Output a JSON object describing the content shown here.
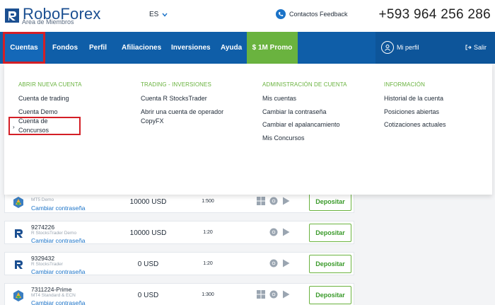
{
  "header": {
    "logo_text": "RoboForex",
    "logo_subtitle": "Área de Miembros",
    "language": "ES",
    "contacts_label": "Contactos Feedback",
    "phone": "+593 964 256 286"
  },
  "nav": {
    "items": [
      "Cuentas",
      "Fondos",
      "Perfil",
      "Afiliaciones",
      "Inversiones",
      "Ayuda"
    ],
    "promo": "$ 1M Promo",
    "profile": "Mi perfil",
    "logout": "Salir"
  },
  "dropdown": {
    "col1": {
      "title": "ABRIR NUEVA CUENTA",
      "links": [
        "Cuenta de trading",
        "Cuenta Demo",
        "Cuenta de Concursos"
      ]
    },
    "col2": {
      "title": "TRADING - INVERSIONES",
      "links": [
        "Cuenta R StocksTrader",
        "Abrir una cuenta de operador",
        "CopyFX"
      ]
    },
    "col3": {
      "title": "ADMINISTRACIÓN DE CUENTA",
      "links": [
        "Mis cuentas",
        "Cambiar la contraseña",
        "Cambiar el apalancamiento",
        "Mis Concursos"
      ]
    },
    "col4": {
      "title": "INFORMACIÓN",
      "links": [
        "Historial de la cuenta",
        "Posiciones abiertas",
        "Cotizaciones actuales"
      ]
    }
  },
  "accounts": [
    {
      "number": "",
      "type": "MT5 Demo",
      "change": "Cambiar contraseña",
      "amount": "10000 USD",
      "leverage": "1:500",
      "deposit": "Depositar"
    },
    {
      "number": "9274226",
      "type": "R StocksTrader Demo",
      "change": "Cambiar contraseña",
      "amount": "10000 USD",
      "leverage": "1:20",
      "deposit": "Depositar"
    },
    {
      "number": "9329432",
      "type": "R StocksTrader",
      "change": "Cambiar contraseña",
      "amount": "0 USD",
      "leverage": "1:20",
      "deposit": "Depositar"
    },
    {
      "number": "7311224-Prime",
      "type": "MT4 Standard & ECN",
      "change": "Cambiar contraseña",
      "amount": "0 USD",
      "leverage": "1:300",
      "deposit": "Depositar"
    }
  ],
  "colors": {
    "nav": "#0f5ea8",
    "promo": "#6ab33f",
    "highlight": "#d41f26",
    "link": "#1b73c8"
  }
}
